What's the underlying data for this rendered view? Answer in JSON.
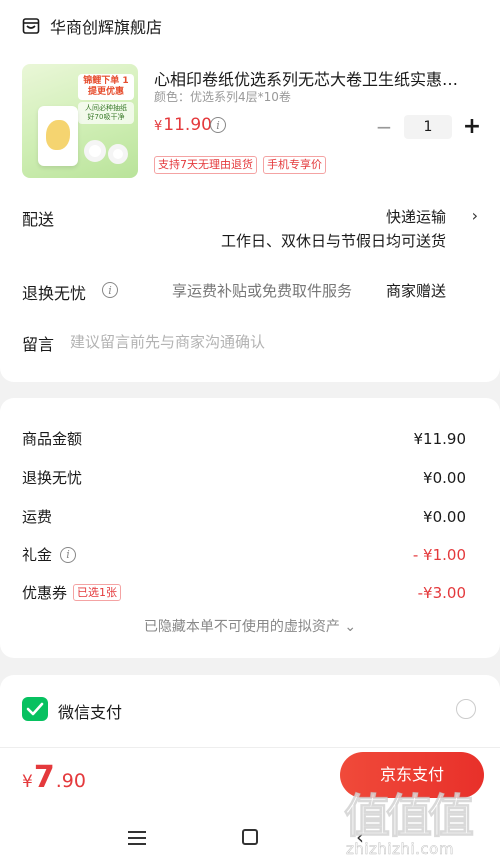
{
  "store": {
    "name": "华商创辉旗舰店",
    "icon": "store-icon"
  },
  "product": {
    "title": "心相印卷纸优选系列无芯大卷卫生纸实惠…",
    "variant": "颜色：优选系列4层*10卷",
    "price_currency": "¥",
    "price_value": "11.90",
    "quantity": "1",
    "minus_label": "−",
    "plus_label": "+",
    "tags": [
      "支持7天无理由退货",
      "手机专享价"
    ],
    "image_badge": "锦鲤下单 1提更优惠",
    "image_note": "人间必种抽纸 好70吸干净"
  },
  "shipping": {
    "label": "配送",
    "value": "快递运输",
    "sub": "工作日、双休日与节假日均可送货"
  },
  "returns": {
    "label": "退换无忧",
    "desc": "享运费补贴或免费取件服务",
    "value": "商家赠送"
  },
  "message": {
    "label": "留言",
    "placeholder": "建议留言前先与商家沟通确认"
  },
  "amounts": {
    "goods_label": "商品金额",
    "goods_value": "¥11.90",
    "returns_label": "退换无忧",
    "returns_value": "¥0.00",
    "freight_label": "运费",
    "freight_value": "¥0.00",
    "gift_label": "礼金",
    "gift_value": "- ¥1.00",
    "coupon_label": "优惠券",
    "coupon_tag": "已选1张",
    "coupon_value": "-¥3.00",
    "hidden_note": "已隐藏本单不可使用的虚拟资产 ⌄"
  },
  "payment": {
    "wechat_label": "微信支付"
  },
  "checkout": {
    "currency": "¥",
    "total_int": "7",
    "total_dec": ".90",
    "pay_button": "京东支付"
  },
  "watermark": {
    "chars": "值值值",
    "url": "zhizhizhi.com"
  },
  "colors": {
    "accent": "#e4393c",
    "wechat": "#07c160"
  }
}
